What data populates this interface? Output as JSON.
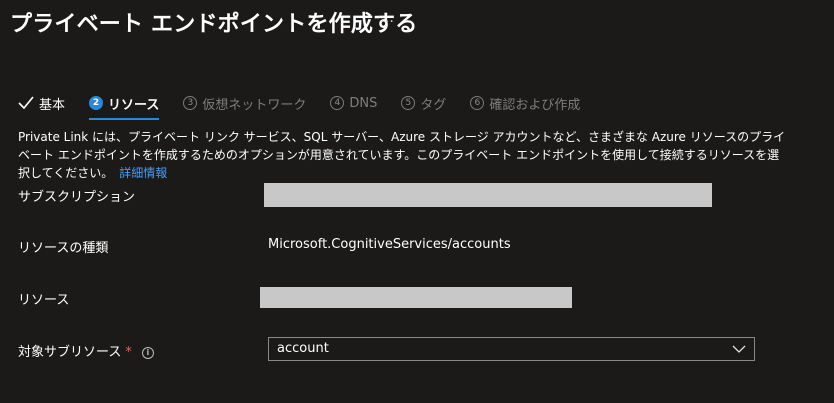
{
  "header": {
    "title": "プライベート エンドポイントを作成する",
    "more_icon": "…"
  },
  "tabs": [
    {
      "label": "基本",
      "status": "done",
      "icon": "check-icon"
    },
    {
      "number": "2",
      "label": "リソース",
      "status": "active"
    },
    {
      "number": "3",
      "label": "仮想ネットワーク",
      "status": "disabled"
    },
    {
      "number": "4",
      "label": "DNS",
      "status": "disabled"
    },
    {
      "number": "5",
      "label": "タグ",
      "status": "disabled"
    },
    {
      "number": "6",
      "label": "確認および作成",
      "status": "disabled"
    }
  ],
  "description": {
    "text": "Private Link には、プライベート リンク サービス、SQL サーバー、Azure ストレージ アカウントなど、さまざまな Azure リソースのプライベート エンドポイントを作成するためのオプションが用意されています。このプライベート エンドポイントを使用して接続するリソースを選択してください。",
    "learn_more": "詳細情報"
  },
  "form": {
    "subscription_label": "サブスクリプション",
    "resource_type_label": "リソースの種類",
    "resource_type_value": "Microsoft.CognitiveServices/accounts",
    "resource_label": "リソース",
    "target_subresource_label": "対象サブリソース",
    "required_mark": "*",
    "info_icon": "i",
    "target_subresource_value": "account"
  },
  "colors": {
    "background": "#1b1a19",
    "accent": "#2b88d8",
    "link": "#479ef5",
    "required": "#ff5a5a",
    "redacted": "#c8c8c8"
  }
}
